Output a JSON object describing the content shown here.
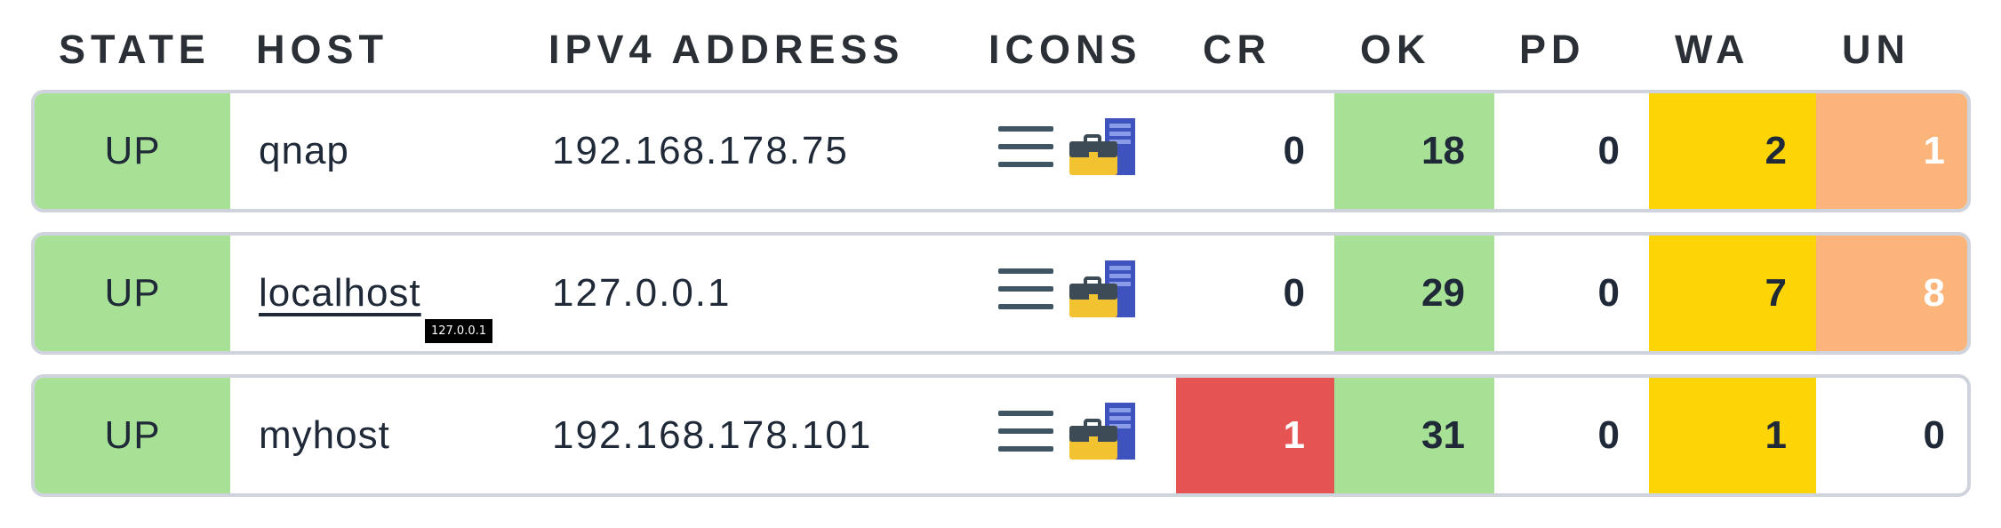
{
  "headers": {
    "state": "STATE",
    "host": "HOST",
    "ipv4": "IPV4 ADDRESS",
    "icons": "ICONS",
    "cr": "CR",
    "ok": "OK",
    "pd": "PD",
    "wa": "WA",
    "un": "UN"
  },
  "rows": [
    {
      "state": "UP",
      "host": "qnap",
      "ipv4": "192.168.178.75",
      "cr": "0",
      "ok": "18",
      "pd": "0",
      "wa": "2",
      "un": "1"
    },
    {
      "state": "UP",
      "host": "localhost",
      "ipv4": "127.0.0.1",
      "cr": "0",
      "ok": "29",
      "pd": "0",
      "wa": "7",
      "un": "8"
    },
    {
      "state": "UP",
      "host": "myhost",
      "ipv4": "192.168.178.101",
      "cr": "1",
      "ok": "31",
      "pd": "0",
      "wa": "1",
      "un": "0"
    }
  ],
  "tooltip": {
    "text": "127.0.0.1"
  },
  "icons": [
    "menu-icon",
    "host-icon"
  ],
  "colors": {
    "state_up": "#a7e196",
    "ok": "#a7e196",
    "critical": "#e65353",
    "warning": "#fdd506",
    "unknown": "#fbb57a",
    "border": "#cfd3db"
  }
}
